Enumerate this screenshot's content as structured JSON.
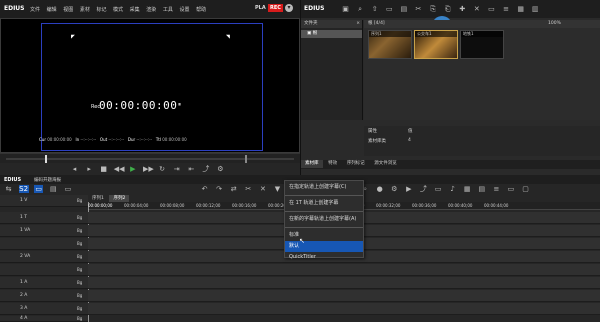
{
  "app": {
    "name": "EDIUS",
    "menu": [
      "文件",
      "编辑",
      "视图",
      "素材",
      "标记",
      "模式",
      "采集",
      "渲染",
      "工具",
      "设置",
      "帮助"
    ],
    "pla_label": "PLA",
    "rec_label": "REC"
  },
  "player": {
    "timecode_prefix": "Rec",
    "timecode": "00:00:00:00",
    "info": {
      "cur_label": "Cur",
      "cur": "00:00:00:00",
      "in_label": "In",
      "in": "--:--:--:--",
      "out_label": "Out",
      "out": "--:--:--:--",
      "dur_label": "Dur",
      "dur": "--:--:--:--",
      "ttl_label": "Ttl",
      "ttl": "00:00:00:00"
    }
  },
  "bin": {
    "brand": "EDIUS",
    "folder_header": "文件夹",
    "folder_root": "根",
    "path": "根 [4/4]",
    "zoom": "100%",
    "clips": [
      {
        "label": "序列1",
        "color": "#4d3a20"
      },
      {
        "label": "公交车1",
        "color": "#6b4a20"
      },
      {
        "label": "地铁1",
        "color": "#1a1a1a"
      }
    ],
    "props": {
      "name_label": "属性",
      "name_value": "值",
      "row_label": "素材库类",
      "row_value": "4"
    },
    "tabs": [
      "素材库",
      "特效",
      "序列标记",
      "源文件浏览"
    ]
  },
  "timeline": {
    "brand": "EDIUS",
    "project": "编码开题海报",
    "sequence_tabs": [
      "序列1",
      "序列2"
    ],
    "ruler": [
      "00:00:00;00",
      "00:00:04;00",
      "00:00:08;00",
      "00:00:12;00",
      "00:00:16;00",
      "00:00:20;00",
      "00:00:24;00",
      "00:00:28;00",
      "00:00:32;00",
      "00:00:36;00",
      "00:00:40;00",
      "00:00:44;00"
    ],
    "tracks": [
      {
        "label": "1 V",
        "tag": "Bg"
      },
      {
        "label": "1 T",
        "tag": "Bg"
      },
      {
        "label": "1 VA",
        "tag": "Bg"
      },
      {
        "label": "",
        "tag": "Bg"
      },
      {
        "label": "2 VA",
        "tag": "Bg"
      },
      {
        "label": "",
        "tag": "Bg"
      },
      {
        "label": "1 A",
        "tag": "Bg"
      },
      {
        "label": "2 A",
        "tag": "Bg"
      },
      {
        "label": "3 A",
        "tag": "Bg"
      },
      {
        "label": "4 A",
        "tag": "Bg"
      }
    ]
  },
  "context_menu": {
    "items": [
      {
        "label": "在指定轨道上创建字幕(C)"
      },
      {
        "label": "在 1T 轨道上创建字幕"
      },
      {
        "label": "在新的字幕轨道上创建字幕(A)"
      },
      {
        "label": "标准"
      },
      {
        "label": "默认"
      },
      {
        "label": "QuickTitler"
      }
    ],
    "selected_index": 4
  },
  "colors": {
    "accent": "#1757b4",
    "rec_red": "#d81c1c",
    "pla_blue": "#2f6fd6"
  }
}
